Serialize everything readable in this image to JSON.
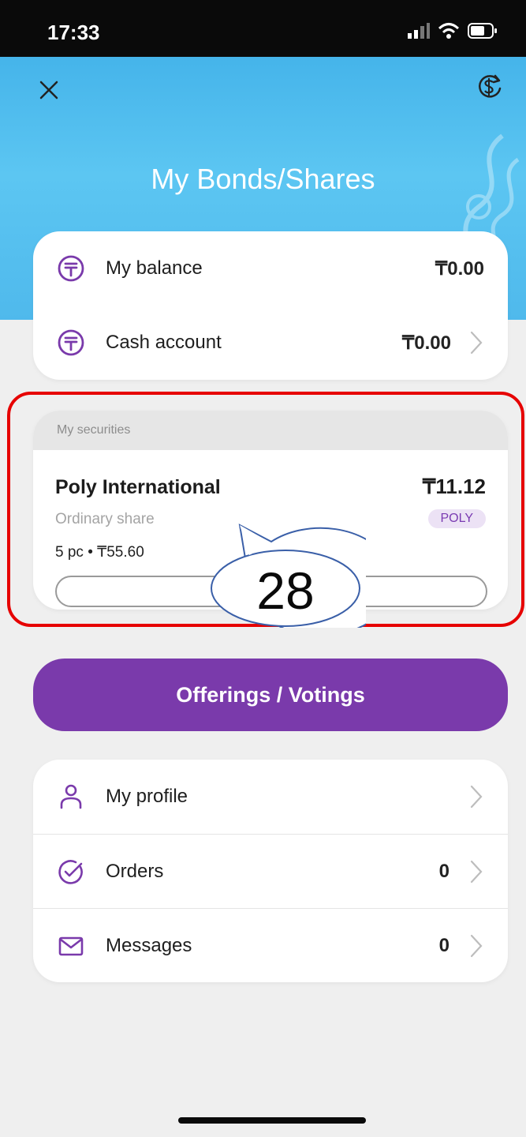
{
  "status_bar": {
    "time": "17:33"
  },
  "header": {
    "title": "My Bonds/Shares"
  },
  "balances": [
    {
      "label": "My balance",
      "value": "₸0.00"
    },
    {
      "label": "Cash account",
      "value": "₸0.00"
    }
  ],
  "securities": {
    "header": "My securities",
    "item": {
      "name": "Poly International",
      "price": "₸11.12",
      "type": "Ordinary share",
      "ticker": "POLY",
      "quantity": "5 pc • ₸55.60"
    }
  },
  "annotation": {
    "number": "28"
  },
  "offerings_button": "Offerings / Votings",
  "menu": [
    {
      "label": "My profile",
      "icon": "user-icon"
    },
    {
      "label": "Orders",
      "count": "0",
      "icon": "check-circle-icon"
    },
    {
      "label": "Messages",
      "count": "0",
      "icon": "envelope-icon"
    }
  ],
  "colors": {
    "accent": "#7a3aab",
    "header_blue": "#4fb9ec",
    "highlight_red": "#e60000"
  }
}
